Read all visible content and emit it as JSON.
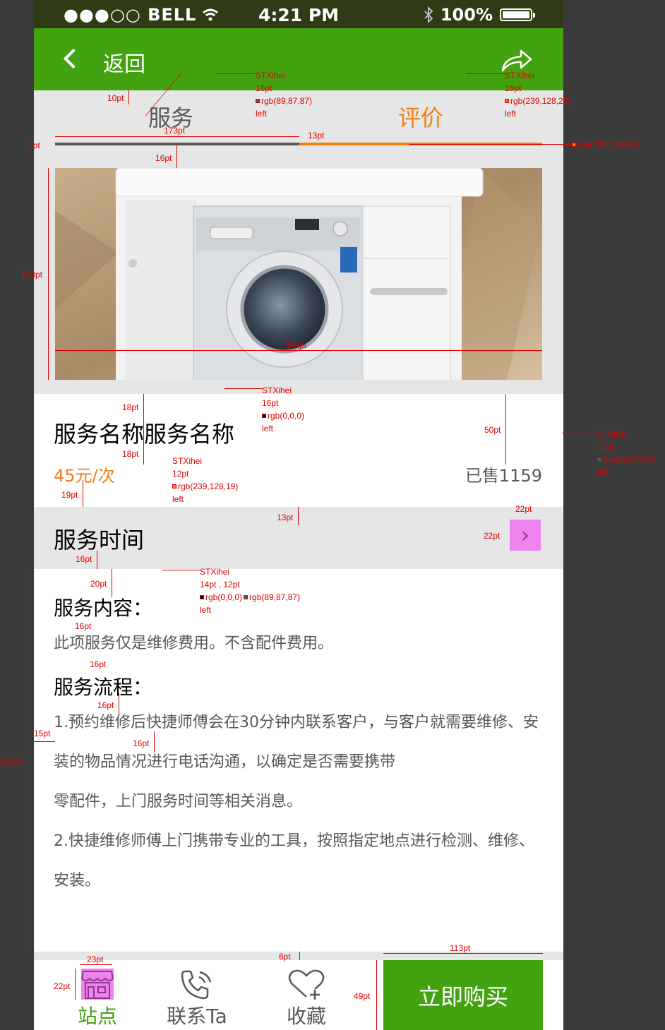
{
  "status_bar": {
    "carrier": "●●●○○ BELL",
    "time": "4:21 PM",
    "battery": "100%"
  },
  "nav": {
    "back_label": "返回",
    "share_icon": "share-icon"
  },
  "tabs": {
    "service": "服务",
    "review": "评价"
  },
  "product": {
    "name": "服务名称服务名称",
    "price": "45元/次",
    "sold": "已售1159"
  },
  "time_row": {
    "label": "服务时间",
    "arrow": "›"
  },
  "details": {
    "content_heading": "服务内容：",
    "content_text": "此项服务仅是维修费用。不含配件费用。",
    "process_heading": "服务流程：",
    "process_text_1": "1.预约维修后快捷师傅会在30分钟内联系客户，与客户就需要维修、安装的物品情况进行电话沟通，以确定是否需要携带",
    "process_text_1b": "零配件，上门服务时间等相关消息。",
    "process_text_2": "2.快捷维修师傅上门携带专业的工具，按照指定地点进行检测、维修、安装。"
  },
  "bottom_bar": {
    "station": "站点",
    "contact": "联系Ta",
    "favorite": "收藏",
    "buy": "立即购买"
  },
  "colors": {
    "green": "#43a20f",
    "orange": "#ef8014",
    "grey_text": "#595757",
    "light_bg": "#e6e6e6"
  },
  "annotations": {
    "nav_font": "STXihei",
    "nav_size": "16pt",
    "nav_color": "rgb(89,87,87)",
    "nav_align": "left",
    "review_font": "STXihei",
    "review_size": "16pt",
    "review_color": "rgb(239,128,20)",
    "review_align": "left",
    "line_color": "rgb(239,128,20)",
    "name_font": "STXihei",
    "name_size": "16pt",
    "name_color": "rgb(0,0,0)",
    "name_align": "left",
    "price_font": "STXihei",
    "price_size": "12pt",
    "price_color": "rgb(239,128,19)",
    "price_align": "left",
    "sold_font": "STXihei",
    "sold_size": "12pt",
    "sold_color": "rgb(89,87,87)",
    "sold_align": "left",
    "detail_font": "STXihei",
    "detail_size": "14pt , 12pt",
    "detail_color1": "rgb(0,0,0)",
    "detail_color2": "rgb(89,87,87)",
    "detail_align": "left",
    "d_10pt": "10pt",
    "d_173pt": "173pt",
    "d_13pt_a": "13pt",
    "d_2pt": "2pt",
    "d_16pt_a": "16pt",
    "d_150pt": "150pt",
    "d_345pt": "345pt",
    "d_18pt_a": "18pt",
    "d_18pt_b": "18pt",
    "d_19pt": "19pt",
    "d_50pt": "50pt",
    "d_13pt_b": "13pt",
    "d_22pt_a": "22pt",
    "d_22pt_b": "22pt",
    "d_16pt_b": "16pt",
    "d_20pt": "20pt",
    "d_16pt_c": "16pt",
    "d_16pt_d": "16pt",
    "d_16pt_e": "16pt",
    "d_15pt": "15pt",
    "d_16pt_f": "16pt",
    "d_270pt": "270pt",
    "d_23pt": "23pt",
    "d_22pt_c": "22pt",
    "d_6pt": "6pt",
    "d_113pt": "113pt",
    "d_49pt": "49pt"
  }
}
